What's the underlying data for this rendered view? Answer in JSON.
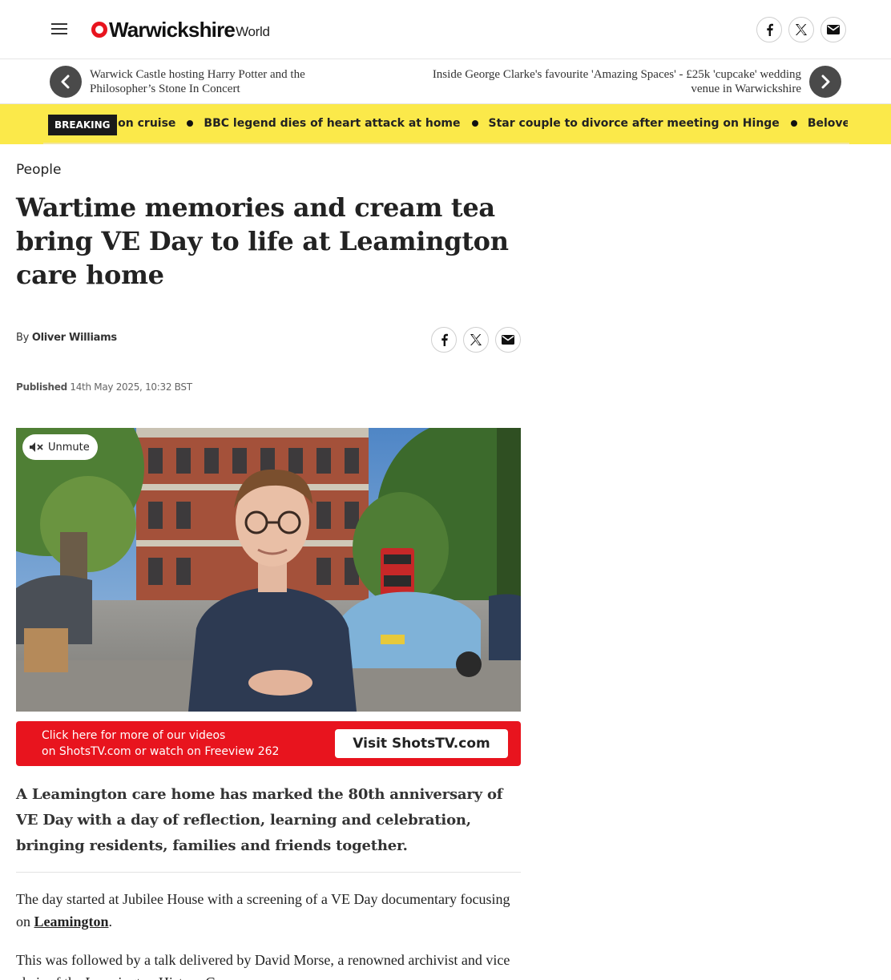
{
  "header": {
    "menu_icon": "hamburger-icon",
    "logo_main": "Warwickshire",
    "logo_sub": "World",
    "share_icons": [
      "facebook-icon",
      "x-icon",
      "email-icon"
    ]
  },
  "nav": {
    "prev_title": "Warwick Castle hosting Harry Potter and the Philosopher’s Stone In Concert",
    "next_title": "Inside George Clarke's favourite 'Amazing Spaces' - £25k 'cupcake' wedding venue in Warwickshire"
  },
  "breaking": {
    "label": "BREAKING",
    "items": [
      "in dies on cruise",
      "BBC legend dies of heart attack at home",
      "Star couple to divorce after meeting on Hinge",
      "Beloved comedian"
    ]
  },
  "article": {
    "section": "People",
    "headline": "Wartime memories and cream tea bring VE Day to life at Leamington care home",
    "byline_prefix": "By",
    "author": "Oliver Williams",
    "published_label": "Published",
    "published_date": "14th May 2025, 10:32 BST",
    "video": {
      "unmute_label": "Unmute"
    },
    "shots": {
      "line1": "Click here for more of our videos",
      "line2": "on ShotsTV.com or watch on Freeview 262",
      "button_label": "Visit ShotsTV.com"
    },
    "standfirst": "A Leamington care home has marked the 80th anniversary of VE Day with a day of reflection, learning and celebration, bringing residents, families and friends together.",
    "para1_before": "The day started at Jubilee House with a screening of a VE Day documentary focusing on ",
    "para1_link": "Leamington",
    "para1_after": ".",
    "para2": "This was followed by a talk delivered by David Morse, a renowned archivist and vice chair of the Leamington History Group."
  },
  "colors": {
    "brand_red": "#e8141e",
    "breaking_yellow": "#fbe94a"
  }
}
